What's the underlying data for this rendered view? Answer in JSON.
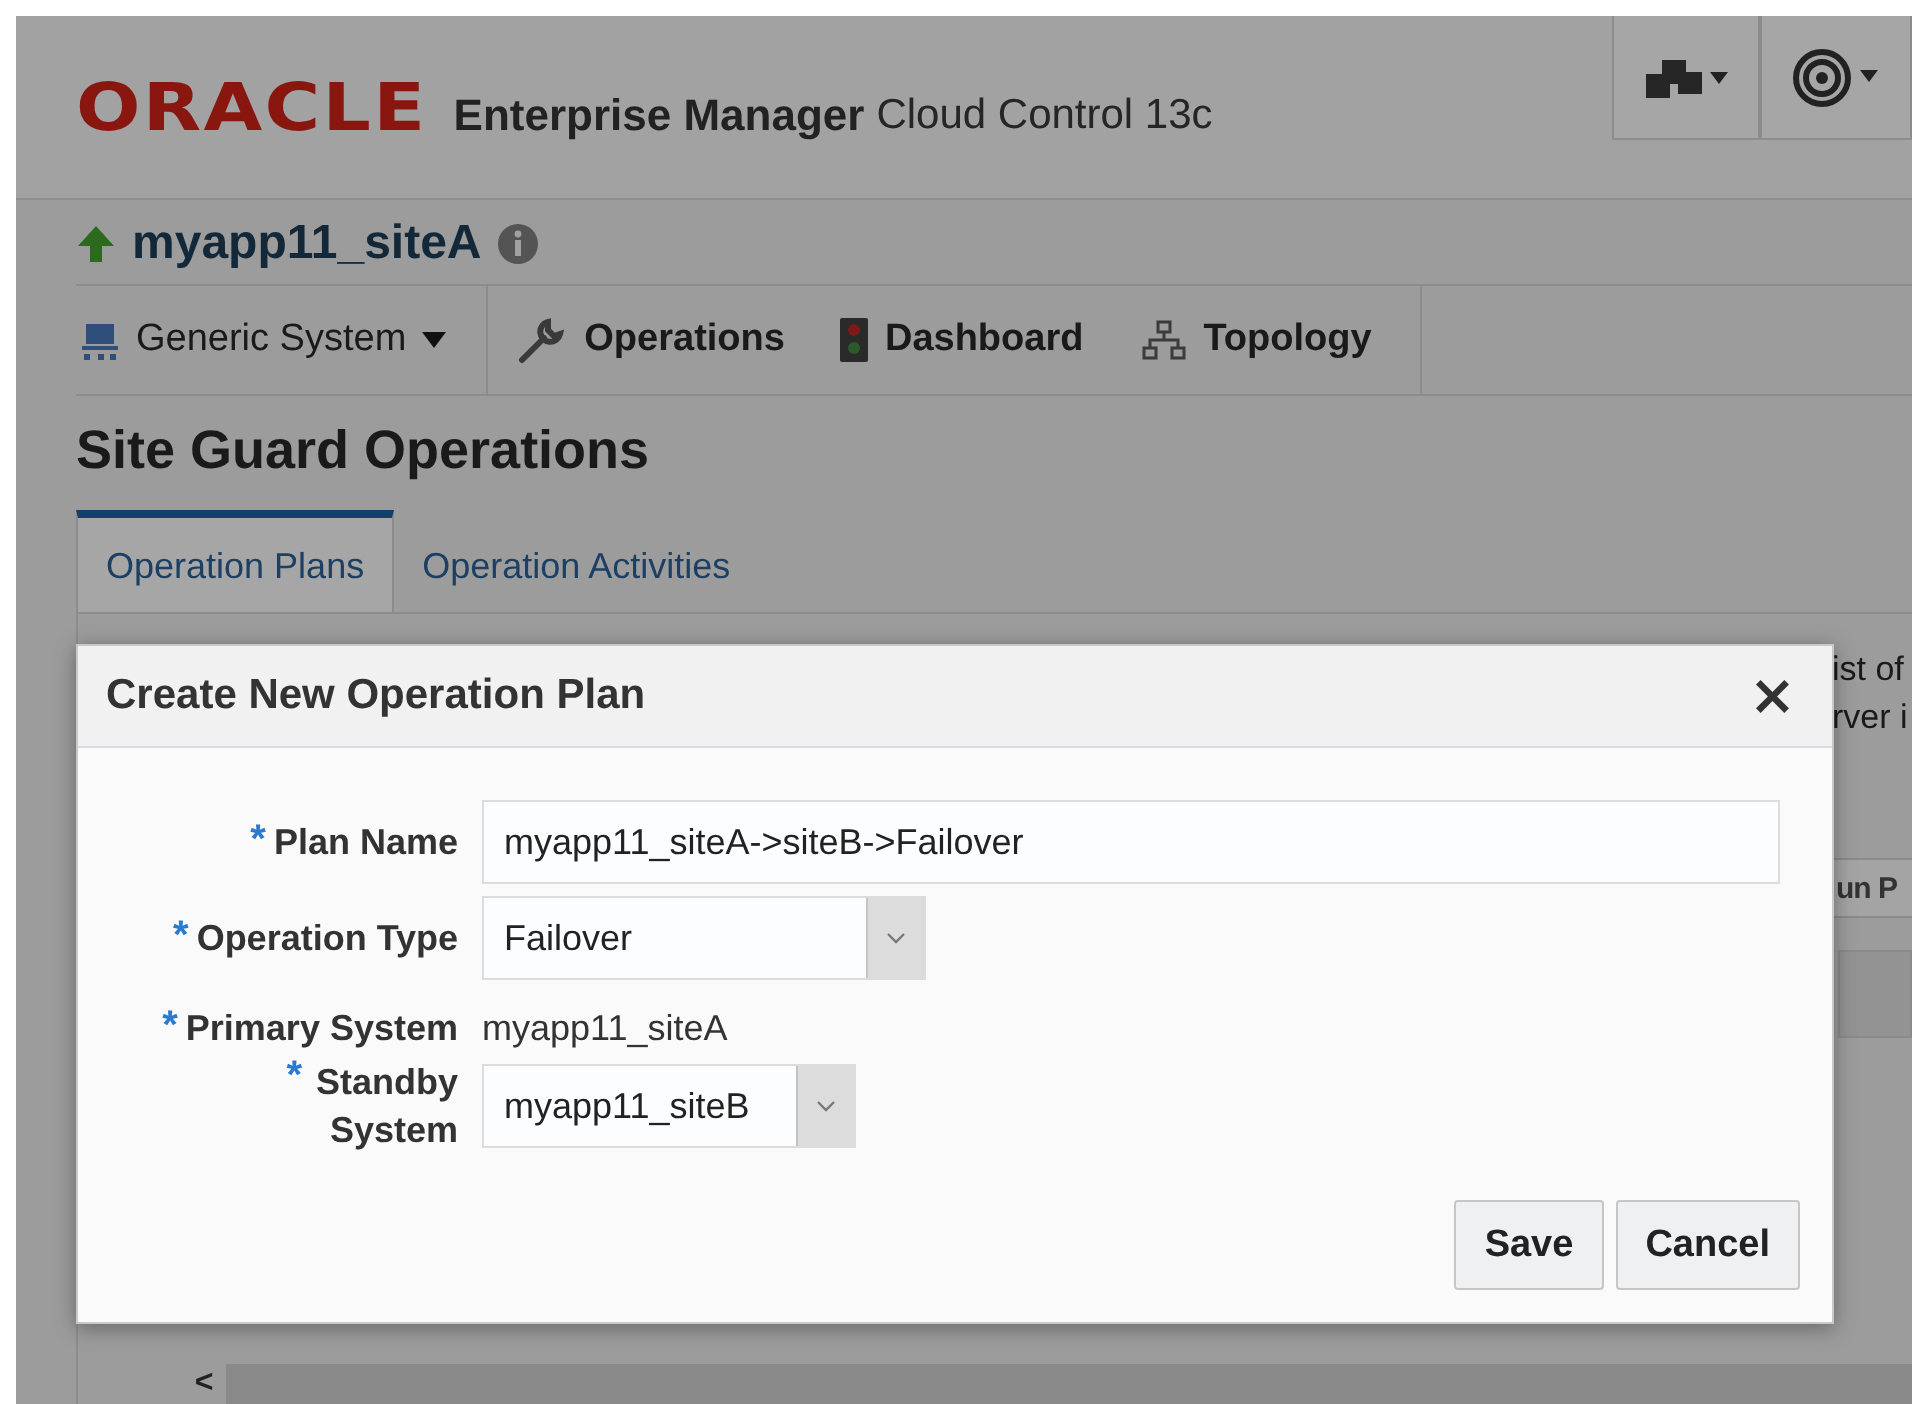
{
  "header": {
    "brand": "ORACLE",
    "product": "Enterprise Manager",
    "edition": "Cloud Control 13c"
  },
  "target": {
    "name": "myapp11_siteA"
  },
  "nav": [
    {
      "label": "Generic System",
      "kind": "menu"
    },
    {
      "label": "Operations",
      "kind": "wrench"
    },
    {
      "label": "Dashboard",
      "kind": "dashboard"
    },
    {
      "label": "Topology",
      "kind": "topology"
    }
  ],
  "page_title": "Site Guard Operations",
  "tabs": [
    {
      "label": "Operation Plans",
      "selected": true
    },
    {
      "label": "Operation Activities",
      "selected": false
    }
  ],
  "background_text": [
    "ist of",
    "rver i"
  ],
  "background_button": "un P",
  "scroll_arrow": "<",
  "dialog": {
    "title": "Create New Operation Plan",
    "close": "×",
    "fields": [
      {
        "marker": "*",
        "label": "Plan Name",
        "kind": "text",
        "value": "myapp11_siteA->siteB->Failover"
      },
      {
        "marker": "*",
        "label": "Operation Type",
        "kind": "select",
        "value": "Failover"
      },
      {
        "marker": "*",
        "label": "Primary System",
        "kind": "static",
        "value": "myapp11_siteA"
      },
      {
        "marker": "*",
        "label": "Standby System",
        "kind": "select",
        "value": "myapp11_siteB"
      }
    ],
    "buttons": [
      "Save",
      "Cancel"
    ]
  }
}
